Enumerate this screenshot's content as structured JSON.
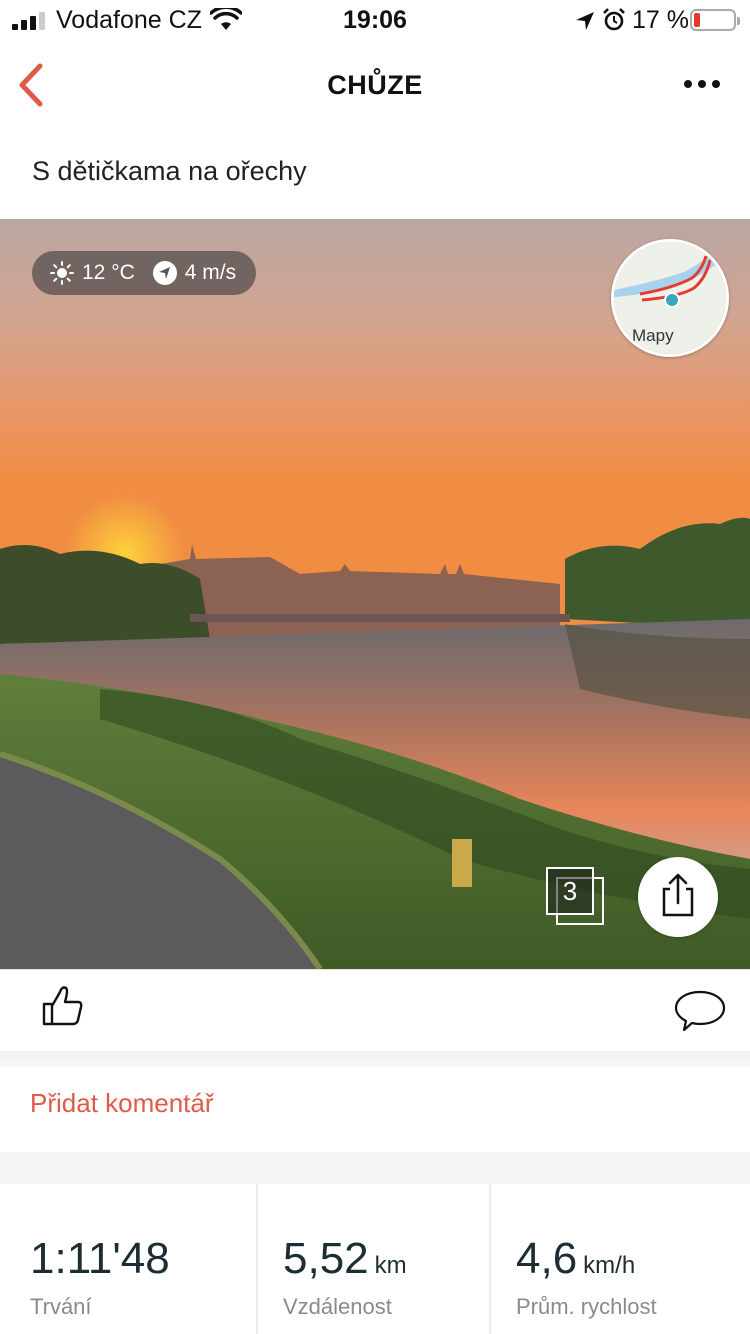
{
  "status_bar": {
    "carrier": "Vodafone CZ",
    "time": "19:06",
    "battery_percent": "17 %",
    "battery_level": 0.17,
    "signal_bars": 3,
    "battery_color": "#e03a2f"
  },
  "nav": {
    "title": "CHŮZE",
    "back_icon": "chevron-left-icon",
    "more_icon": "ellipsis-icon"
  },
  "activity": {
    "title": "S dětičkama na ořechy"
  },
  "photo": {
    "weather": {
      "temperature": "12 °C",
      "wind": "4 m/s",
      "temperature_icon": "sun-icon",
      "wind_icon": "wind-direction-icon"
    },
    "map_label": "Mapy",
    "photo_count": "3",
    "share_icon": "share-icon"
  },
  "actions": {
    "like_icon": "thumbs-up-icon",
    "comment_icon": "speech-bubble-icon"
  },
  "comment": {
    "add_label": "Přidat komentář"
  },
  "stats": [
    {
      "value": "1:11'48",
      "unit": "",
      "label": "Trvání"
    },
    {
      "value": "5,52",
      "unit": "km",
      "label": "Vzdálenost"
    },
    {
      "value": "4,6",
      "unit": "km/h",
      "label": "Prům. rychlost"
    }
  ],
  "colors": {
    "accent": "#e05a48",
    "stat_value": "#1c2d33"
  }
}
